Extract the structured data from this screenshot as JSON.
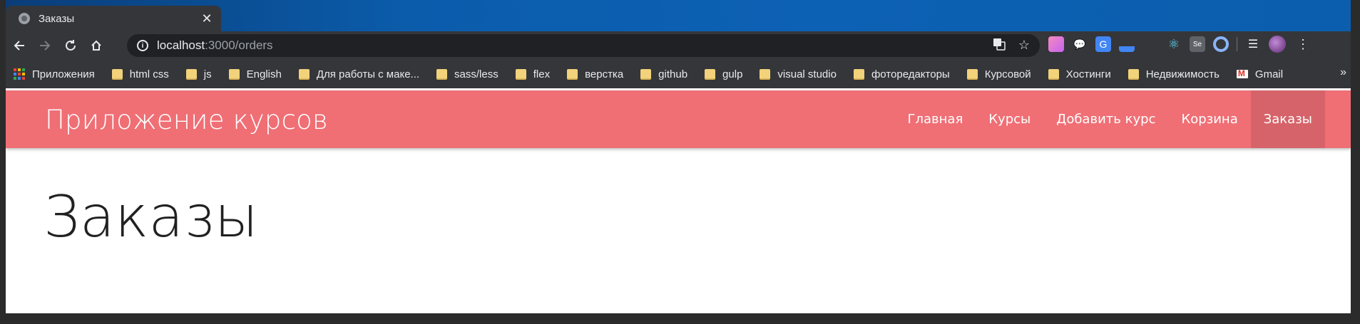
{
  "browser": {
    "tab_title": "Заказы",
    "tab_close": "✕",
    "url_host": "localhost",
    "url_path": ":3000/orders"
  },
  "bookmarks": {
    "apps_label": "Приложения",
    "items": [
      "html css",
      "js",
      "English",
      "Для работы с маке...",
      "sass/less",
      "flex",
      "верстка",
      "github",
      "gulp",
      "visual studio",
      "фоторедакторы",
      "Курсовой",
      "Хостинги",
      "Недвижимость"
    ],
    "gmail_label": "Gmail",
    "more": "»"
  },
  "app": {
    "brand": "Приложение курсов",
    "nav": [
      "Главная",
      "Курсы",
      "Добавить курс",
      "Корзина",
      "Заказы"
    ],
    "active_nav": "Заказы",
    "accent_color": "#ef6f75",
    "page_title": "Заказы"
  }
}
